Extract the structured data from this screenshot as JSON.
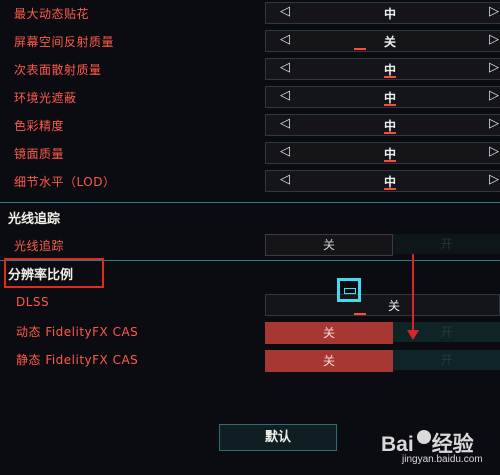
{
  "settings": [
    {
      "label": "最大动态贴花",
      "value": "中"
    },
    {
      "label": "屏幕空间反射质量",
      "value": "关"
    },
    {
      "label": "次表面散射质量",
      "value": "中"
    },
    {
      "label": "环境光遮蔽",
      "value": "中"
    },
    {
      "label": "色彩精度",
      "value": "中"
    },
    {
      "label": "镜面质量",
      "value": "中"
    },
    {
      "label": "细节水平（LOD）",
      "value": "中"
    }
  ],
  "arrows": {
    "left": "◁",
    "right": "▷"
  },
  "ray_tracing": {
    "section_title": "光线追踪",
    "row_label": "光线追踪",
    "off_label": "关",
    "on_label": "开"
  },
  "resolution": {
    "section_title": "分辨率比例",
    "dlss_label": "DLSS",
    "dlss_value": "关",
    "dynamic_label": "动态 FidelityFX CAS",
    "static_label": "静态 FidelityFX CAS",
    "off_label": "关",
    "on_label": "开"
  },
  "default_button": "默认",
  "watermark": {
    "brand": "Bai",
    "brand2": "经验",
    "url": "jingyan.baidu.com"
  },
  "colors": {
    "accent_red": "#ff5a48",
    "cyan": "#2f7d86"
  }
}
